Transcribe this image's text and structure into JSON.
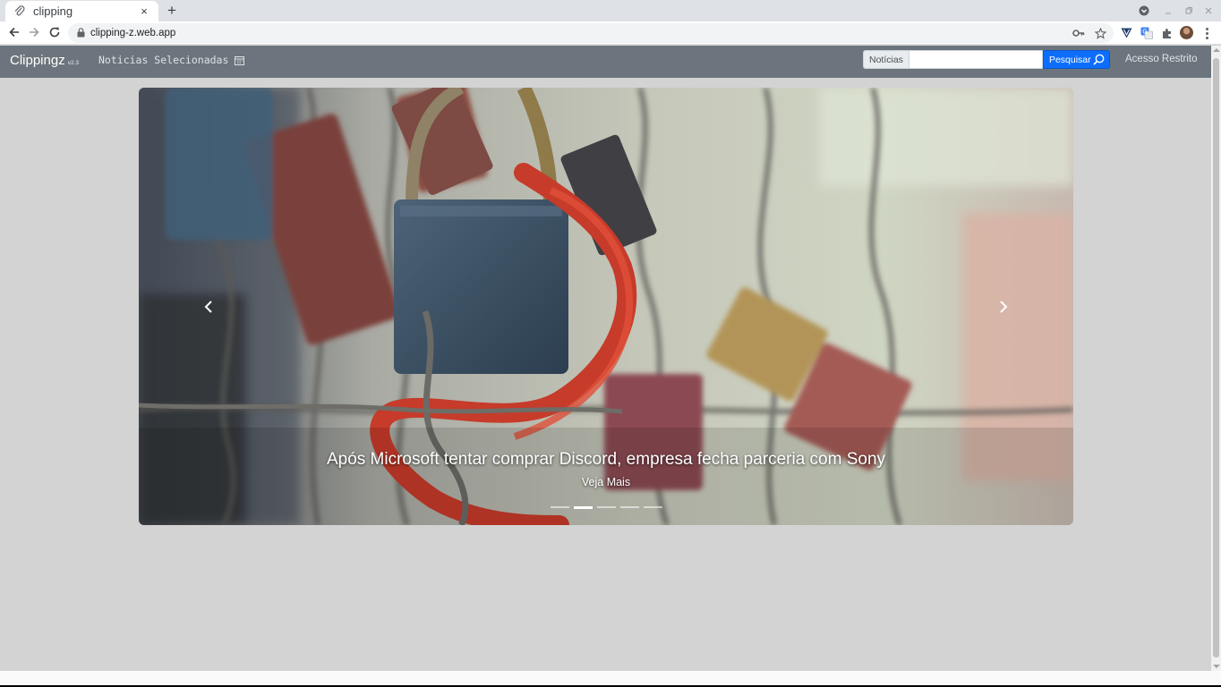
{
  "browser": {
    "tab_title": "clipping",
    "tab_close": "×",
    "new_tab": "+",
    "url": "clipping-z.web.app",
    "icons": [
      "paperclip-icon",
      "close-icon",
      "plus-icon",
      "back-icon",
      "forward-icon",
      "reload-icon",
      "lock-icon",
      "key-icon",
      "star-icon",
      "extension-v-icon",
      "translate-icon",
      "puzzle-icon",
      "avatar",
      "menu-icon",
      "minimize-icon",
      "restore-icon",
      "close-window-icon"
    ]
  },
  "navbar": {
    "brand": "Clippingz",
    "version": "v2.3",
    "nav_link": "Noticias Selecionadas",
    "search_scope": "Notícias",
    "search_placeholder": "",
    "search_button": "Pesquisar",
    "login_link": "Acesso Restrito",
    "colors": {
      "bar": "#6c757d",
      "button": "#0d6efd"
    }
  },
  "carousel": {
    "caption_title": "Após Microsoft tentar comprar Discord, empresa fecha parceria com Sony",
    "caption_link": "Veja Mais",
    "slides": 5,
    "active_slide": 2,
    "image": "padlocks-on-fence-photo"
  }
}
